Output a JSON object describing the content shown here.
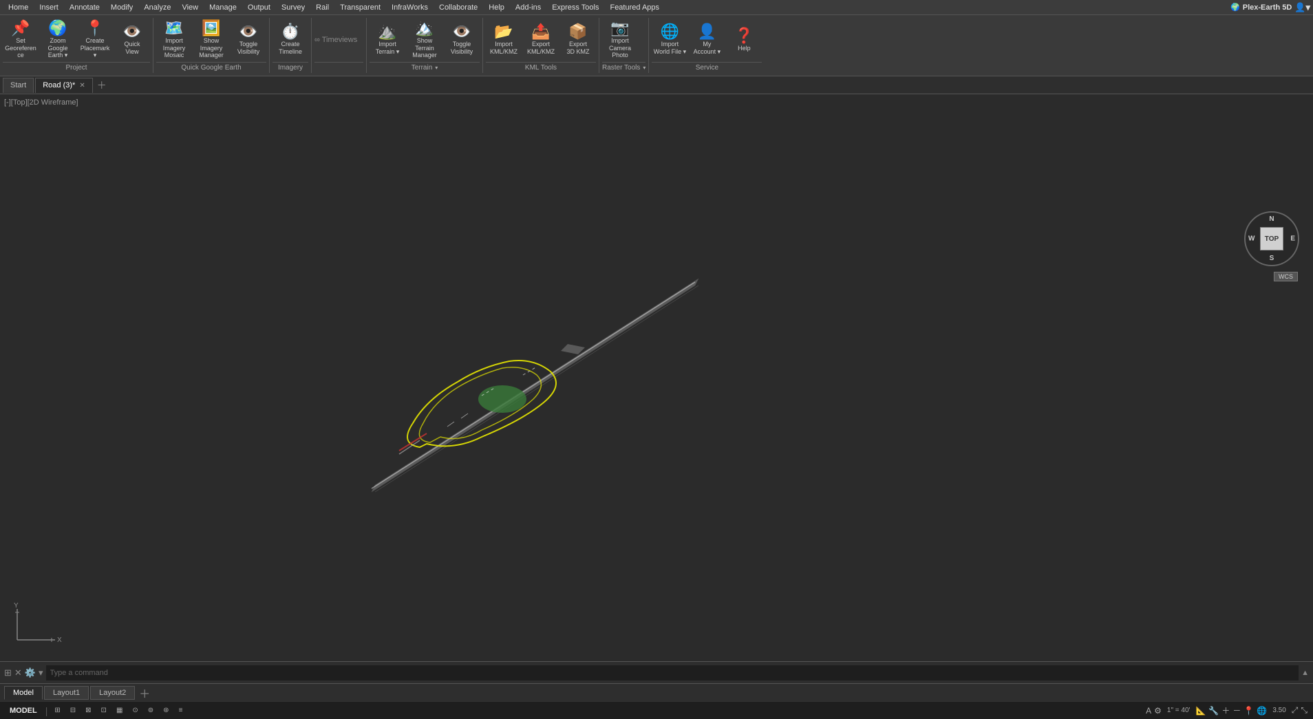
{
  "app": {
    "title": "Plex-Earth 5D",
    "brand_icon": "🌍"
  },
  "menubar": {
    "items": [
      "Home",
      "Insert",
      "Annotate",
      "Modify",
      "Analyze",
      "View",
      "Manage",
      "Output",
      "Survey",
      "Rail",
      "Transparent",
      "InfraWorks",
      "Collaborate",
      "Help",
      "Add-ins",
      "Express Tools",
      "Featured Apps"
    ]
  },
  "ribbon": {
    "groups": [
      {
        "label": "Project",
        "buttons": [
          {
            "id": "set-georeference",
            "icon": "📌",
            "label": "Set\nGeoreference"
          },
          {
            "id": "zoom-google-earth",
            "icon": "🌍",
            "label": "Zoom\nGoogle Earth",
            "dropdown": true
          },
          {
            "id": "create-placemark",
            "icon": "📍",
            "label": "Create\nPlacemark",
            "dropdown": true
          },
          {
            "id": "quick-view",
            "icon": "👁️",
            "label": "Quick\nView"
          }
        ]
      },
      {
        "label": "Quick Google Earth",
        "buttons": [
          {
            "id": "import-imagery-mosaic",
            "icon": "🗺️",
            "label": "Import Imagery\nMosaic"
          },
          {
            "id": "show-imagery-manager",
            "icon": "🖼️",
            "label": "Show Imagery\nManager"
          },
          {
            "id": "toggle-visibility",
            "icon": "👁️",
            "label": "Toggle\nVisibility"
          }
        ]
      },
      {
        "label": "Imagery",
        "buttons": [
          {
            "id": "create-timeline",
            "icon": "⏱️",
            "label": "Create\nTimeline"
          }
        ]
      },
      {
        "label": "Timeviews",
        "is_timeviews": true
      },
      {
        "label": "Terrain",
        "has_dropdown": true,
        "buttons": [
          {
            "id": "import-terrain",
            "icon": "⛰️",
            "label": "Import\nTerrain",
            "dropdown": true
          },
          {
            "id": "show-terrain-manager",
            "icon": "🏔️",
            "label": "Show Terrain\nManager"
          },
          {
            "id": "toggle-visibility2",
            "icon": "👁️",
            "label": "Toggle\nVisibility"
          }
        ]
      },
      {
        "label": "KML Tools",
        "buttons": [
          {
            "id": "import-kml-kmz",
            "icon": "📂",
            "label": "Import\nKML/KMZ"
          },
          {
            "id": "export-kml-kmz",
            "icon": "📤",
            "label": "Export\nKML/KMZ"
          },
          {
            "id": "export-3d-kmz",
            "icon": "📦",
            "label": "Export\n3D KMZ"
          }
        ]
      },
      {
        "label": "Raster Tools",
        "has_dropdown": true,
        "buttons": [
          {
            "id": "import-camera-photo",
            "icon": "📷",
            "label": "Import\nCamera Photo"
          }
        ]
      },
      {
        "label": "Service",
        "buttons": [
          {
            "id": "import-world-file",
            "icon": "🌐",
            "label": "Import\nWorld File",
            "dropdown": true
          },
          {
            "id": "my-account",
            "icon": "👤",
            "label": "My\nAccount",
            "dropdown": true
          },
          {
            "id": "help",
            "icon": "❓",
            "label": "Help"
          }
        ]
      }
    ]
  },
  "doc_tabs": {
    "tabs": [
      {
        "id": "start",
        "label": "Start",
        "closable": false,
        "active": false
      },
      {
        "id": "road3",
        "label": "Road (3)*",
        "closable": true,
        "active": true
      }
    ]
  },
  "viewport": {
    "label": "[-][Top][2D Wireframe]"
  },
  "compass": {
    "n": "N",
    "s": "S",
    "e": "E",
    "w": "W",
    "top_label": "TOP",
    "wcs_label": "WCS"
  },
  "layout_tabs": {
    "tabs": [
      {
        "id": "model",
        "label": "Model",
        "active": true
      },
      {
        "id": "layout1",
        "label": "Layout1",
        "active": false
      },
      {
        "id": "layout2",
        "label": "Layout2",
        "active": false
      }
    ]
  },
  "statusbar": {
    "model_label": "MODEL",
    "scale_label": "1\" = 40'",
    "value_label": "3.50",
    "items": [
      "⊞",
      "⊟",
      "⊠",
      "⊡",
      "▦",
      "⊙",
      "⊚",
      "⊛"
    ]
  },
  "cmdbar": {
    "placeholder": "Type a command"
  }
}
